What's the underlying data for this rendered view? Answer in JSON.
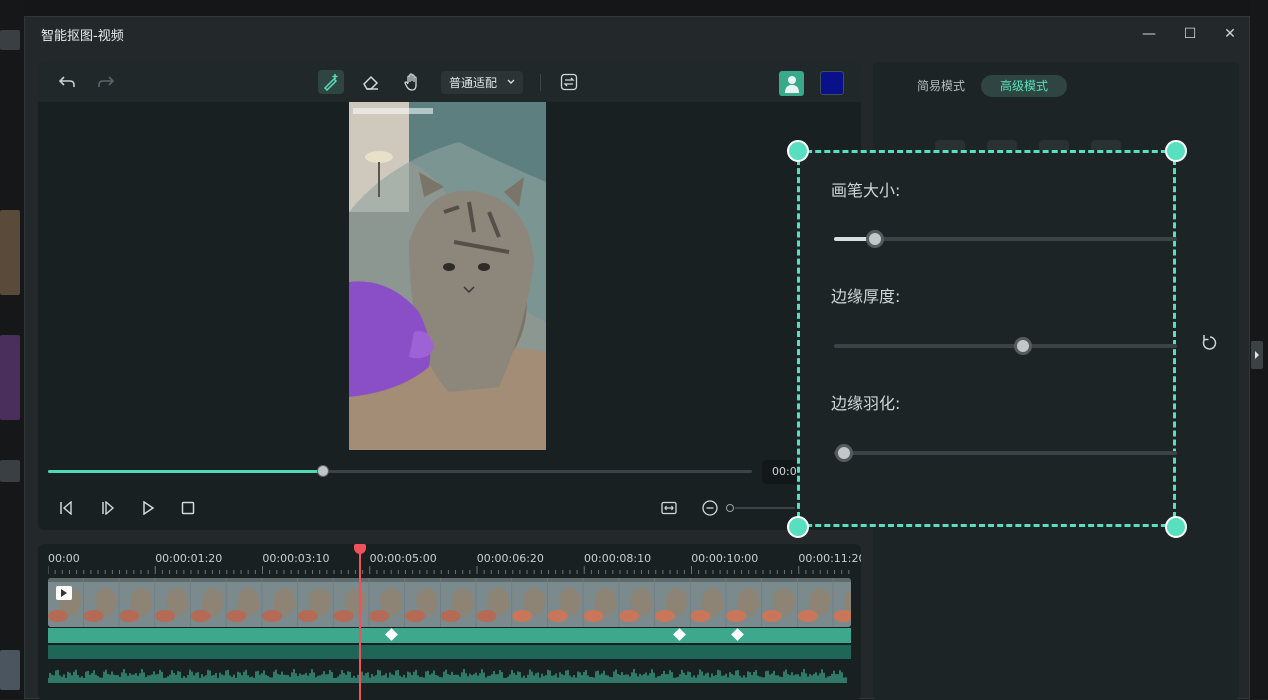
{
  "window": {
    "title": "智能抠图-视频"
  },
  "toolbar": {
    "fit_mode": "普通适配",
    "mask_color": "#0a108a"
  },
  "player": {
    "timecode": "00:0",
    "progress_fraction": 0.39
  },
  "timeline": {
    "ruler": [
      "00:00",
      "00:00:01:20",
      "00:00:03:10",
      "00:00:05:00",
      "00:00:06:20",
      "00:00:08:10",
      "00:00:10:00",
      "00:00:11:20"
    ]
  },
  "settings": {
    "tab_simple": "简易模式",
    "tab_advanced": "高级模式",
    "brush_size_label": "画笔大小:",
    "edge_thickness_label": "边缘厚度:",
    "edge_feather_label": "边缘羽化:",
    "brush_size_value": 0.12,
    "edge_thickness_value": 0.55,
    "edge_feather_value": 0.03
  },
  "colors": {
    "accent": "#58dfc0",
    "playhead": "#f0525b"
  },
  "icons": [
    "undo-icon",
    "redo-icon",
    "brush-add-icon",
    "eraser-icon",
    "hand-icon",
    "chevron-down-icon",
    "swap-icon",
    "person-icon",
    "prev-frame-icon",
    "next-frame-icon",
    "play-icon",
    "stop-icon",
    "fit-width-icon",
    "zoom-out-icon",
    "reset-icon",
    "close-icon",
    "maximize-icon",
    "minimize-icon"
  ]
}
